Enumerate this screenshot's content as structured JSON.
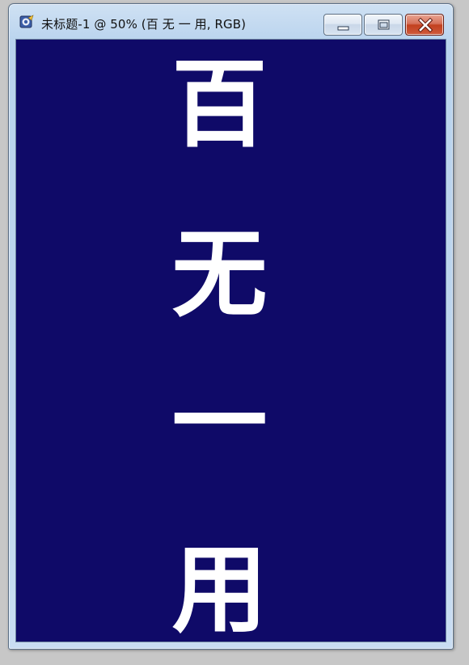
{
  "window": {
    "title": "未标题-1 @ 50% (百 无 一 用, RGB)",
    "icon": "photoshop-document-icon",
    "controls": {
      "minimize": "minimize-icon",
      "maximize": "maximize-icon",
      "close": "close-icon"
    }
  },
  "canvas": {
    "background_color": "#0f0a68",
    "text_color": "#ffffff",
    "characters": [
      "百",
      "无",
      "一",
      "用"
    ]
  }
}
